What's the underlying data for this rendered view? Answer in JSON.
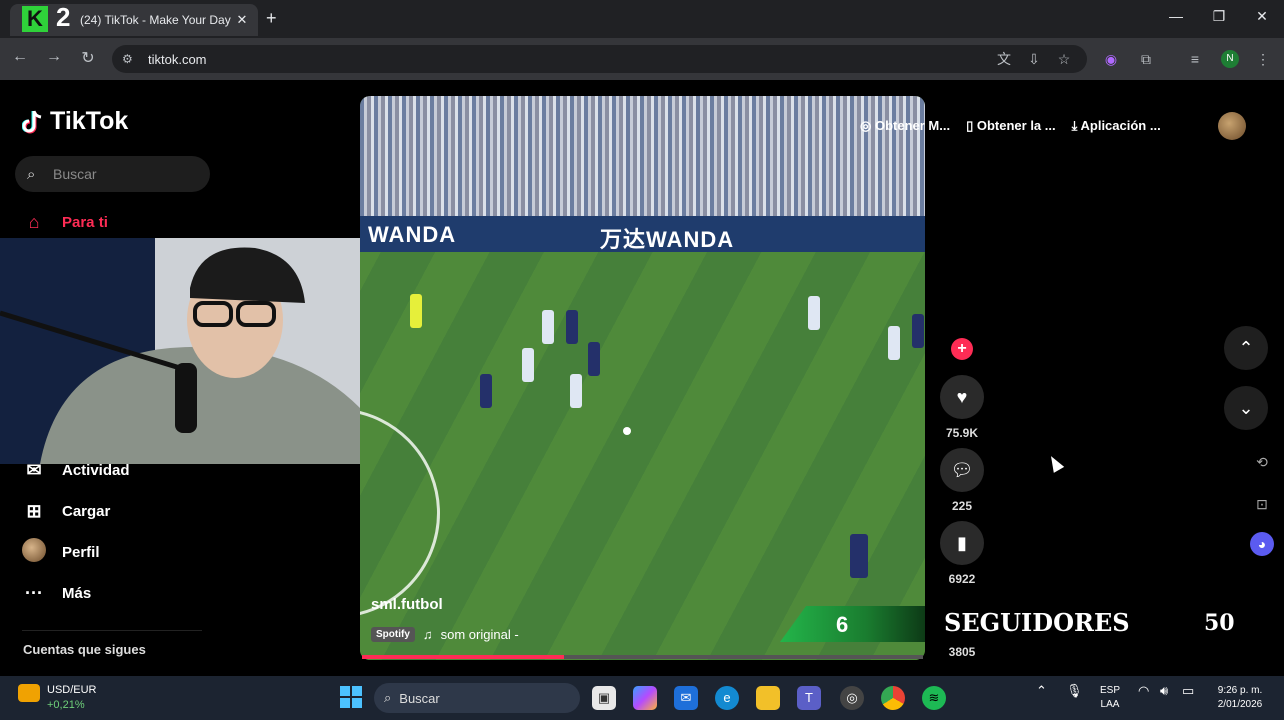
{
  "browser": {
    "tab_title": "(24) TikTok - Make Your Day",
    "tab_close": "✕",
    "new_tab": "+",
    "url": "tiktok.com",
    "streamer_logo_letter": "K",
    "streamer_logo_number": "2",
    "profile_initial": "N"
  },
  "sidebar": {
    "brand": "TikTok",
    "search_placeholder": "Buscar",
    "items": [
      {
        "label": "Para ti",
        "icon": "home-icon"
      },
      {
        "label": "Actividad",
        "icon": "inbox-icon"
      },
      {
        "label": "Cargar",
        "icon": "upload-icon"
      },
      {
        "label": "Perfil",
        "icon": "profile-avatar-icon"
      },
      {
        "label": "Más",
        "icon": "more-dots-icon"
      }
    ],
    "following_heading": "Cuentas que sigues"
  },
  "video": {
    "creator": "sml.futbol",
    "spotify_tag": "Spotify",
    "sound": "som original -",
    "ad_left": "WANDA",
    "ad_center": "万达WANDA",
    "score_overlay": "6",
    "progress_fraction": 0.36
  },
  "top_actions": {
    "item1": "Obtener M...",
    "item2": "Obtener la ...",
    "item3": "Aplicación ..."
  },
  "rail": {
    "likes": "75.9K",
    "comments": "225",
    "saves": "6922",
    "shares": "3805"
  },
  "overlay": {
    "followers_label": "SEGUIDORES",
    "followers_count": "50"
  },
  "taskbar": {
    "fx_pair": "USD/EUR",
    "fx_change": "+0,21%",
    "search": "Buscar",
    "lang1": "ESP",
    "lang2": "LAA",
    "time": "9:26 p. m.",
    "date": "2/01/2026"
  },
  "colors": {
    "tiktok_red": "#fe2c55",
    "chrome_dark": "#202124",
    "taskbar": "#1c2431"
  }
}
